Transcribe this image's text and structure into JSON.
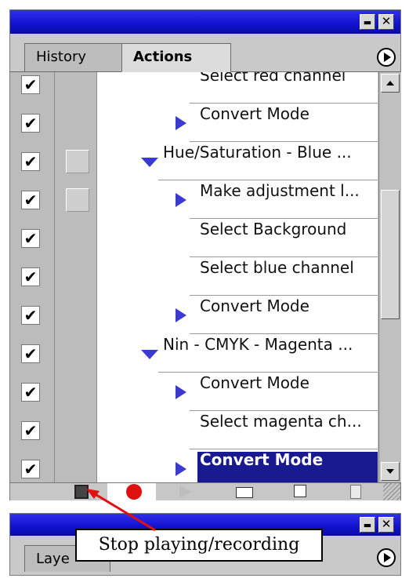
{
  "window": {
    "minimize_glyph": "▬",
    "close_glyph": "✕"
  },
  "tabs": [
    {
      "label": "History",
      "active": false
    },
    {
      "label": "Actions",
      "active": true
    }
  ],
  "actions_list": [
    {
      "label": "Select red channel",
      "indent": "step",
      "expanded": null,
      "checked": true,
      "dialog": false
    },
    {
      "label": "Convert Mode",
      "indent": "step",
      "expanded": false,
      "checked": true,
      "dialog": false
    },
    {
      "label": "Hue/Saturation - Blue ...",
      "indent": "action",
      "expanded": true,
      "checked": true,
      "dialog": true
    },
    {
      "label": "Make adjustment l...",
      "indent": "step",
      "expanded": false,
      "checked": true,
      "dialog": true
    },
    {
      "label": "Select Background",
      "indent": "step",
      "expanded": null,
      "checked": true,
      "dialog": false
    },
    {
      "label": "Select blue channel",
      "indent": "step",
      "expanded": null,
      "checked": true,
      "dialog": false
    },
    {
      "label": "Convert Mode",
      "indent": "step",
      "expanded": false,
      "checked": true,
      "dialog": false
    },
    {
      "label": "Nin - CMYK - Magenta ...",
      "indent": "action",
      "expanded": true,
      "checked": true,
      "dialog": false
    },
    {
      "label": "Convert Mode",
      "indent": "step",
      "expanded": false,
      "checked": true,
      "dialog": false
    },
    {
      "label": "Select magenta ch...",
      "indent": "step",
      "expanded": null,
      "checked": true,
      "dialog": false
    },
    {
      "label": "Convert Mode",
      "indent": "step",
      "expanded": false,
      "checked": true,
      "dialog": false,
      "selected": true
    }
  ],
  "check_glyph": "✔",
  "toolbar": {
    "buttons": [
      "stop-button",
      "record-button",
      "play-button",
      "new-set-button",
      "new-action-button",
      "delete-button"
    ]
  },
  "second_panel": {
    "tab_label": "Laye"
  },
  "tooltip": {
    "text": "Stop playing/recording",
    "arrow_color": "#e01010"
  },
  "colors": {
    "title_bar": "#1111cc",
    "selection": "#1a1a90",
    "triangle": "#3a3ad0"
  }
}
